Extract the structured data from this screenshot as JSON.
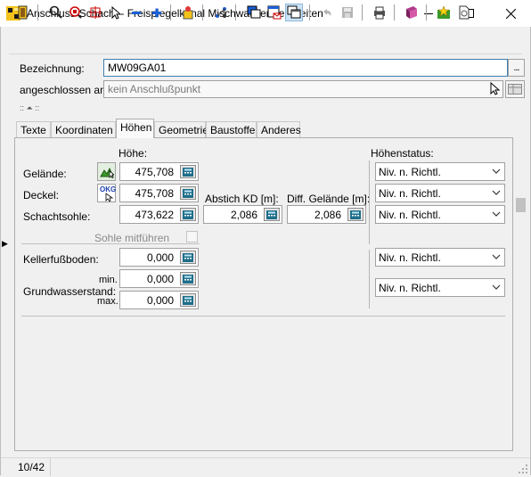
{
  "window": {
    "title": "Anschluss-Schacht - Freispiegelkanal Mischwasser bearbeiten",
    "minimize_icon": "minimize-icon",
    "maximize_icon": "maximize-icon",
    "close_icon": "close-icon"
  },
  "toolbar": {
    "buttons": [
      "exit-door-icon",
      "zoom-icon",
      "zoom-extents-icon",
      "crosshair-icon",
      "pointer-icon",
      "zoom-out-icon",
      "zoom-in-icon",
      "wizard-icon",
      "network-icon",
      "window-stack-icon",
      "window-mail-icon",
      "window-copy-icon",
      "undo-icon",
      "save-icon",
      "print-icon",
      "book-icon",
      "star-icon",
      "document-icon"
    ]
  },
  "form": {
    "bezeichnung_label": "Bezeichnung:",
    "bezeichnung_value": "MW09GA01",
    "ellipsis": "...",
    "angeschlossen_label": "angeschlossen an:",
    "angeschlossen_value": "kein Anschlußpunkt",
    "splitter": ":: ⏶ ::"
  },
  "tabs": [
    "Texte",
    "Koordinaten",
    "Höhen",
    "Geometrie",
    "Baustoffe",
    "Anderes"
  ],
  "active_tab": "Höhen",
  "hoehen": {
    "hoehe_header": "Höhe:",
    "status_header": "Höhenstatus:",
    "gelaende_label": "Gelände:",
    "gelaende_value": "475,708",
    "deckel_label": "Deckel:",
    "deckel_value": "475,708",
    "okg_badge": "OKG",
    "schachtsohle_label": "Schachtsohle:",
    "schachtsohle_value": "473,622",
    "abstich_label": "Abstich KD [m]:",
    "abstich_value": "2,086",
    "diff_label": "Diff. Gelände [m]:",
    "diff_value": "2,086",
    "sohle_mitfuehren_label": "Sohle mitführen",
    "kellerfussboden_label": "Kellerfußboden:",
    "kellerfussboden_value": "0,000",
    "min_label": "min.",
    "min_value": "0,000",
    "grundwasserstand_label": "Grundwasserstand:",
    "max_label": "max.",
    "max_value": "0,000",
    "status_gelaende": "Niv. n. Richtl.",
    "status_deckel": "Niv. n. Richtl.",
    "status_schachtsohle": "Niv. n. Richtl.",
    "status_kellerfussboden": "Niv. n. Richtl.",
    "status_grundwasser": "Niv. n. Richtl."
  },
  "statusbar": {
    "record": "10/42"
  },
  "colors": {
    "accent": "#3c7fb1",
    "calc_button": "#1f6f8b"
  }
}
